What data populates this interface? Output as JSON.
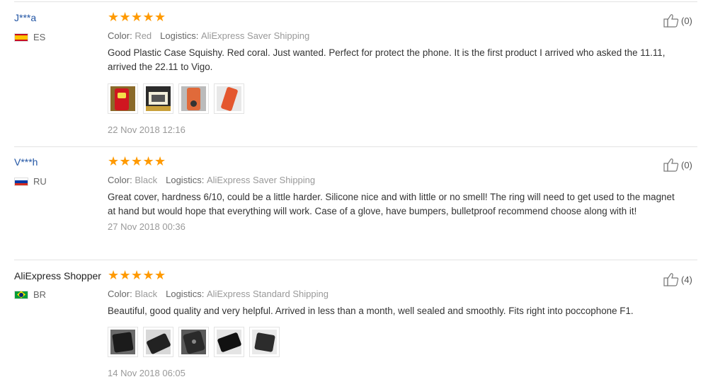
{
  "labels": {
    "color": "Color:",
    "logistics": "Logistics:"
  },
  "reviews": [
    {
      "username": "J***a",
      "country": "ES",
      "flag": "es",
      "rating": 5,
      "color": "Red",
      "logistics": "AliExpress Saver Shipping",
      "text": "Good Plastic Case Squishy. Red coral. Just wanted. Perfect for protect the phone. It is the first product I arrived who asked the 11.11, arrived the 22.11 to Vigo.",
      "photos": 4,
      "date": "22 Nov 2018 12:16",
      "likes": "(0)"
    },
    {
      "username": "V***h",
      "country": "RU",
      "flag": "ru",
      "rating": 5,
      "color": "Black",
      "logistics": "AliExpress Saver Shipping",
      "text": "Great cover, hardness 6/10, could be a little harder. Silicone nice and with little or no smell! The ring will need to get used to the magnet at hand but would hope that everything will work. Case of a glove, have bumpers, bulletproof recommend choose along with it!",
      "photos": 0,
      "date": "27 Nov 2018 00:36",
      "likes": "(0)"
    },
    {
      "username": "AliExpress Shopper",
      "country": "BR",
      "flag": "br",
      "rating": 5,
      "color": "Black",
      "logistics": "AliExpress Standard Shipping",
      "text": "Beautiful, good quality and very helpful. Arrived in less than a month, well sealed and smoothly. Fits right into poccophone F1.",
      "photos": 5,
      "date": "14 Nov 2018 06:05",
      "likes": "(4)"
    }
  ],
  "colors": {
    "star": "#ff9a00",
    "username": "#2255a4",
    "divider": "#e3e3e3"
  }
}
